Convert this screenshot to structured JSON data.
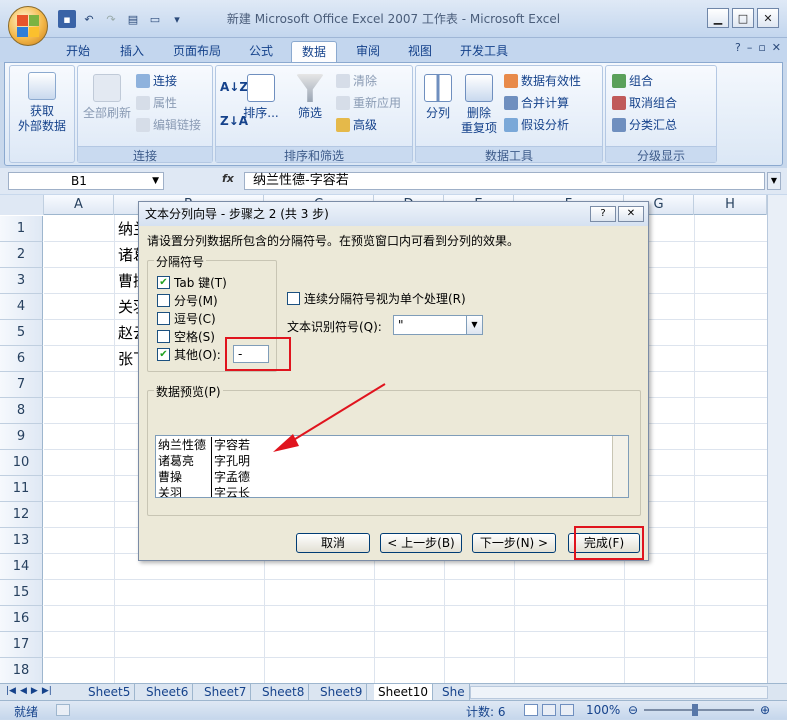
{
  "window": {
    "title": "新建 Microsoft Office Excel 2007 工作表 - Microsoft Excel"
  },
  "ribbon": {
    "tabs": [
      "开始",
      "插入",
      "页面布局",
      "公式",
      "数据",
      "审阅",
      "视图",
      "开发工具"
    ],
    "active_tab": "数据",
    "groups": {
      "get_external": {
        "label": "获取\n外部数据"
      },
      "connections": {
        "label": "连接",
        "refresh_all": "全部刷新",
        "connect": "连接",
        "properties": "属性",
        "edit_links": "编辑链接"
      },
      "sort_filter": {
        "label": "排序和筛选",
        "sort": "排序...",
        "filter": "筛选",
        "clear": "清除",
        "reapply": "重新应用",
        "advanced": "高级"
      },
      "data_tools": {
        "label": "数据工具",
        "split": "分列",
        "remove_dup": "删除\n重复项",
        "validation": "数据有效性",
        "consolidate": "合并计算",
        "whatif": "假设分析"
      },
      "outline": {
        "label": "分级显示",
        "group": "组合",
        "ungroup": "取消组合",
        "subtotal": "分类汇总"
      }
    }
  },
  "formula_bar": {
    "name_box": "B1",
    "fx": "fx",
    "content": "纳兰性德-字容若"
  },
  "grid": {
    "columns": [
      "A",
      "B",
      "C",
      "D",
      "E",
      "F",
      "G",
      "H"
    ],
    "rows": [
      "1",
      "2",
      "3",
      "4",
      "5",
      "6",
      "7",
      "8",
      "9",
      "10",
      "11",
      "12",
      "13",
      "14",
      "15",
      "16",
      "17",
      "18"
    ],
    "cells": [
      "纳兰",
      "诸葛",
      "曹操",
      "关羽",
      "赵云",
      "张飞"
    ]
  },
  "sheets": [
    "Sheet5",
    "Sheet6",
    "Sheet7",
    "Sheet8",
    "Sheet9",
    "Sheet10",
    "She"
  ],
  "active_sheet": "Sheet10",
  "status": {
    "mode": "就绪",
    "count": "计数: 6",
    "zoom": "100%"
  },
  "dialog": {
    "title": "文本分列向导 - 步骤之 2 (共 3 步)",
    "info": "请设置分列数据所包含的分隔符号。在预览窗口内可看到分列的效果。",
    "delimiters_legend": "分隔符号",
    "options": [
      {
        "label": "Tab 键(T)",
        "checked": true
      },
      {
        "label": "分号(M)",
        "checked": false
      },
      {
        "label": "逗号(C)",
        "checked": false
      },
      {
        "label": "空格(S)",
        "checked": false
      },
      {
        "label": "其他(O):",
        "checked": true
      }
    ],
    "other_value": "-",
    "consecutive_label": "连续分隔符号视为单个处理(R)",
    "qualifier_label": "文本识别符号(Q):",
    "qualifier_value": "\"",
    "preview_legend": "数据预览(P)",
    "preview_rows": [
      [
        "纳兰性德",
        "字容若"
      ],
      [
        "诸葛亮",
        "字孔明"
      ],
      [
        "曹操",
        "字孟德"
      ],
      [
        "关羽",
        "字云长"
      ]
    ],
    "buttons": {
      "cancel": "取消",
      "back": "< 上一步(B)",
      "next": "下一步(N) >",
      "finish": "完成(F)"
    }
  },
  "colors": {
    "accent_red": "#e0141e",
    "ribbon_text": "#15428b"
  }
}
